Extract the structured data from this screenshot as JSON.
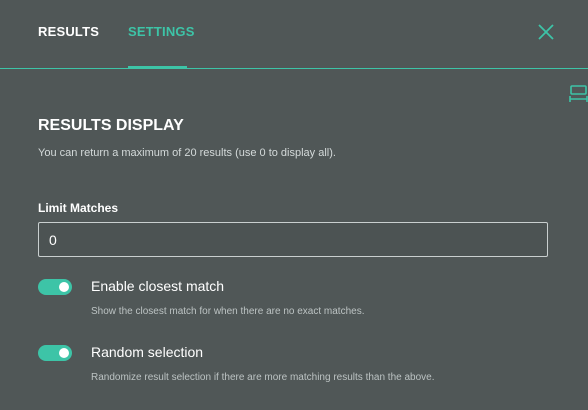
{
  "tabs": [
    {
      "label": "RESULTS",
      "active": false
    },
    {
      "label": "SETTINGS",
      "active": true
    }
  ],
  "icons": {
    "close": "close-icon",
    "side": "expand-horizontal-icon"
  },
  "colors": {
    "background": "#505757",
    "accent": "#3dc4a7",
    "text": "#ffffff",
    "muted_text": "#bcc3c3"
  },
  "section": {
    "title": "RESULTS DISPLAY",
    "description": "You can return a maximum of 20 results (use 0 to display all)."
  },
  "limit_matches": {
    "label": "Limit Matches",
    "value": "0"
  },
  "options": [
    {
      "title": "Enable closest match",
      "description": "Show the closest match for when there are no exact matches.",
      "enabled": true
    },
    {
      "title": "Random selection",
      "description": "Randomize result selection if there are more matching results than the above.",
      "enabled": true
    }
  ]
}
